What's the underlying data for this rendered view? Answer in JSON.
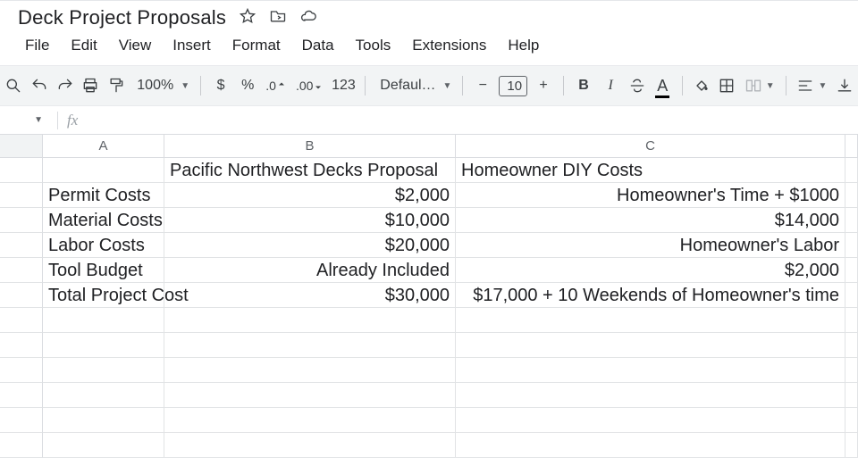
{
  "doc": {
    "title": "Deck Project Proposals"
  },
  "menu": [
    "File",
    "Edit",
    "View",
    "Insert",
    "Format",
    "Data",
    "Tools",
    "Extensions",
    "Help"
  ],
  "toolbar": {
    "zoom": "100%",
    "currency": "$",
    "percent": "%",
    "dec_dec": ".0",
    "dec_inc": ".00",
    "numfmt": "123",
    "font": "Defaul…",
    "minus": "−",
    "fontsize": "10",
    "plus": "+",
    "bold": "B",
    "italic": "I",
    "textcolor_letter": "A"
  },
  "columns": [
    "A",
    "B",
    "C"
  ],
  "grid": {
    "headers": {
      "B": "Pacific Northwest Decks Proposal",
      "C": "Homeowner DIY Costs"
    },
    "rows": [
      {
        "label": "Permit Costs",
        "b": "$2,000",
        "c": "Homeowner's Time + $1000"
      },
      {
        "label": "Material Costs",
        "b": "$10,000",
        "c": "$14,000"
      },
      {
        "label": "Labor Costs",
        "b": "$20,000",
        "c": "Homeowner's Labor"
      },
      {
        "label": "Tool Budget",
        "b": "Already Included",
        "c": "$2,000"
      },
      {
        "label": "Total Project Cost",
        "b": "$30,000",
        "c": "$17,000 + 10 Weekends of Homeowner's time"
      }
    ]
  }
}
